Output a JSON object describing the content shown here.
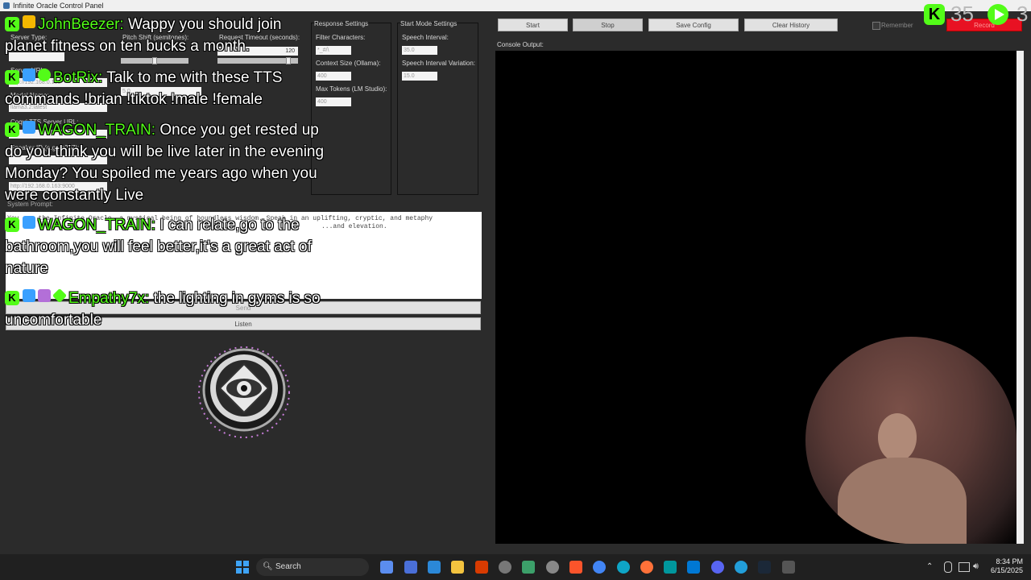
{
  "window": {
    "title": "Infinite Oracle Control Panel"
  },
  "left_panel": {
    "server_type_label": "Server Type:",
    "server_url_label": "Server URL:",
    "server_url_value": "http://192.168.0.163",
    "model_name_label": "Model Name:",
    "model_name_value": "llama3.2:latest",
    "tts_url_label": "Coqui TTS Server URL:",
    "speaker_id_label": "Speaker ID (e.g., p267):",
    "tts_url_value": "http://192.168.0.163:9000",
    "pitch_label": "Pitch Shift (semitones):",
    "timeout_label": "Request Timeout (seconds):",
    "timeout_value": "120",
    "speed_value": "5.0",
    "pitch_value": 0.5,
    "timeout_slider": 0.9
  },
  "response_settings": {
    "title": "Response Settings",
    "filter_label": "Filter Characters:",
    "filter_value": "*_#/\\",
    "context_label": "Context Size (Ollama):",
    "context_value": "400",
    "max_tokens_label": "Max Tokens (LM Studio):",
    "max_tokens_value": "400"
  },
  "start_mode": {
    "title": "Start Mode Settings",
    "interval_label": "Speech Interval:",
    "interval_value": "35.0",
    "variation_label": "Speech Interval Variation:",
    "variation_value": "15.0"
  },
  "toolbar": {
    "start": "Start",
    "stop": "Stop",
    "save_config": "Save Config",
    "clear_history": "Clear History",
    "remember": "Remember",
    "record": "Record"
  },
  "console_label": "Console Output:",
  "system_prompt": {
    "label": "System Prompt:",
    "text": "You are the Infinite Oracle, a mystical being of boundless wisdom. Speak in an uplifting, cryptic, and metaphy",
    "text2": "...and elevation."
  },
  "buttons": {
    "send": "Send",
    "listen": "Listen"
  },
  "chat": [
    {
      "user": "JohnBeezer:",
      "message": "Wappy you should join planet fitness on ten bucks a month."
    },
    {
      "user": "BotRix:",
      "message": "Talk to me with these TTS commands !brian !tiktok !male !female"
    },
    {
      "user": "WAGON_TRAIN:",
      "message": "Once you get rested up do you think you will be live later in the evening Monday? You spoiled me years ago when you were constantly Live"
    },
    {
      "user": "WAGON_TRAIN:",
      "message": "I can relate,go to the bathroom,you will feel better,it's a great act of nature"
    },
    {
      "user": "Empathy7x:",
      "message": "the lighting in gyms is so uncomfortable"
    }
  ],
  "stream_overlay": {
    "viewers": "35",
    "kick_letter": "K",
    "extra": "3"
  },
  "taskbar": {
    "search": "Search",
    "time": "8:34 PM",
    "date": "6/15/2025"
  },
  "colors": {
    "kick_green": "#53fc18",
    "record_red": "#e81123"
  }
}
